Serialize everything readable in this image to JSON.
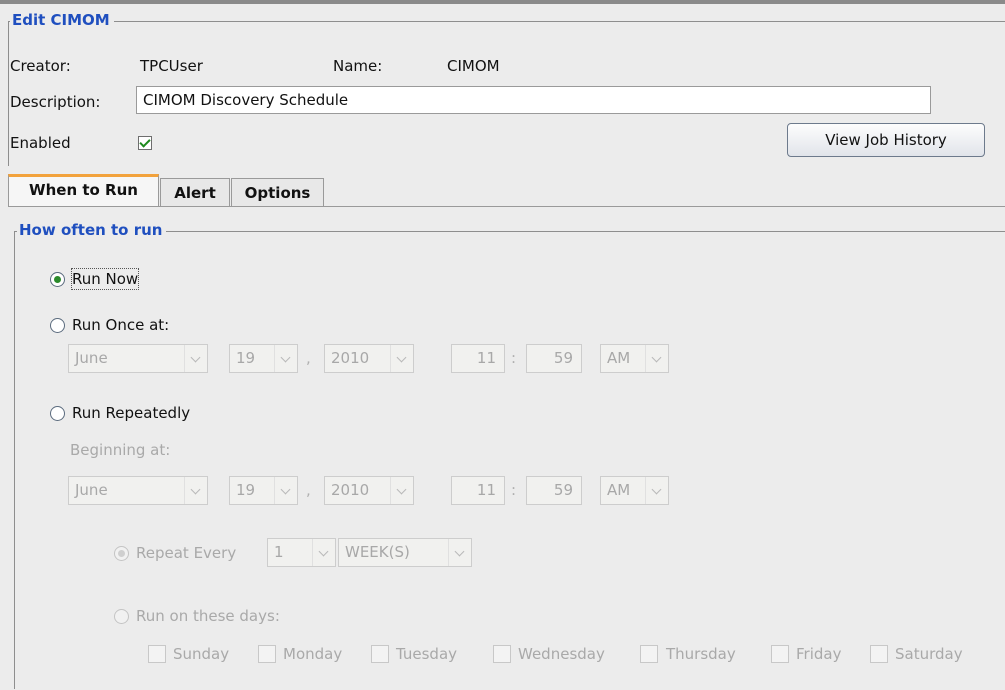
{
  "edit_section": {
    "legend": "Edit CIMOM",
    "creator_label": "Creator:",
    "creator_value": "TPCUser",
    "name_label": "Name:",
    "name_value": "CIMOM",
    "description_label": "Description:",
    "description_value": "CIMOM Discovery Schedule",
    "enabled_label": "Enabled",
    "enabled_checked": true,
    "view_history_button": "View Job History"
  },
  "tabs": [
    {
      "label": "When to Run",
      "active": true
    },
    {
      "label": "Alert",
      "active": false
    },
    {
      "label": "Options",
      "active": false
    }
  ],
  "how_often": {
    "legend": "How often to run",
    "selected": "run_now",
    "run_now_label": "Run Now",
    "run_once_label": "Run Once at:",
    "run_once": {
      "month": "June",
      "day": "19",
      "year": "2010",
      "hour": "11",
      "minute": "59",
      "ampm": "AM",
      "comma": ",",
      "colon": ":"
    },
    "run_repeatedly_label": "Run Repeatedly",
    "beginning_label": "Beginning at:",
    "beginning": {
      "month": "June",
      "day": "19",
      "year": "2010",
      "hour": "11",
      "minute": "59",
      "ampm": "AM",
      "comma": ",",
      "colon": ":"
    },
    "repeat_every_label": "Repeat Every",
    "repeat_every_value": "1",
    "repeat_every_unit": "WEEK(S)",
    "run_on_days_label": "Run on these days:",
    "days": [
      "Sunday",
      "Monday",
      "Tuesday",
      "Wednesday",
      "Thursday",
      "Friday",
      "Saturday"
    ]
  }
}
